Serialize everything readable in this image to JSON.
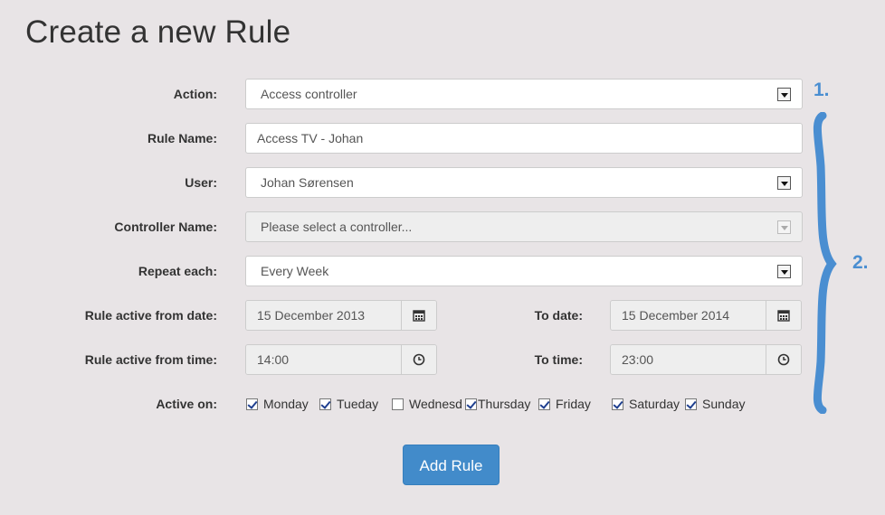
{
  "page": {
    "title": "Create a new Rule"
  },
  "form": {
    "action": {
      "label": "Action:",
      "value": "Access controller"
    },
    "rule_name": {
      "label": "Rule Name:",
      "value": "Access TV - Johan"
    },
    "user": {
      "label": "User:",
      "value": "Johan Sørensen"
    },
    "controller": {
      "label": "Controller Name:",
      "placeholder": "Please select a controller..."
    },
    "repeat": {
      "label": "Repeat each:",
      "value": "Every Week"
    },
    "from_date": {
      "label": "Rule active from date:",
      "value": "15 December 2013"
    },
    "to_date": {
      "label": "To date:",
      "value": "15 December 2014"
    },
    "from_time": {
      "label": "Rule active from time:",
      "value": "14:00"
    },
    "to_time": {
      "label": "To time:",
      "value": "23:00"
    },
    "active_on": {
      "label": "Active on:",
      "days": [
        {
          "label": "Monday",
          "checked": true
        },
        {
          "label": "Tueday",
          "checked": true
        },
        {
          "label": "Wednesd",
          "checked": false
        },
        {
          "label": "Thursday",
          "checked": true
        },
        {
          "label": "Friday",
          "checked": true
        },
        {
          "label": "Saturday",
          "checked": true
        },
        {
          "label": "Sunday",
          "checked": true
        }
      ]
    },
    "submit_label": "Add Rule"
  },
  "annotations": {
    "one": "1.",
    "two": "2."
  },
  "colors": {
    "accent": "#428bca",
    "annotation": "#4a8ed1",
    "background": "#e8e4e6"
  },
  "icons": {
    "calendar": "calendar-icon",
    "clock": "clock-icon"
  }
}
